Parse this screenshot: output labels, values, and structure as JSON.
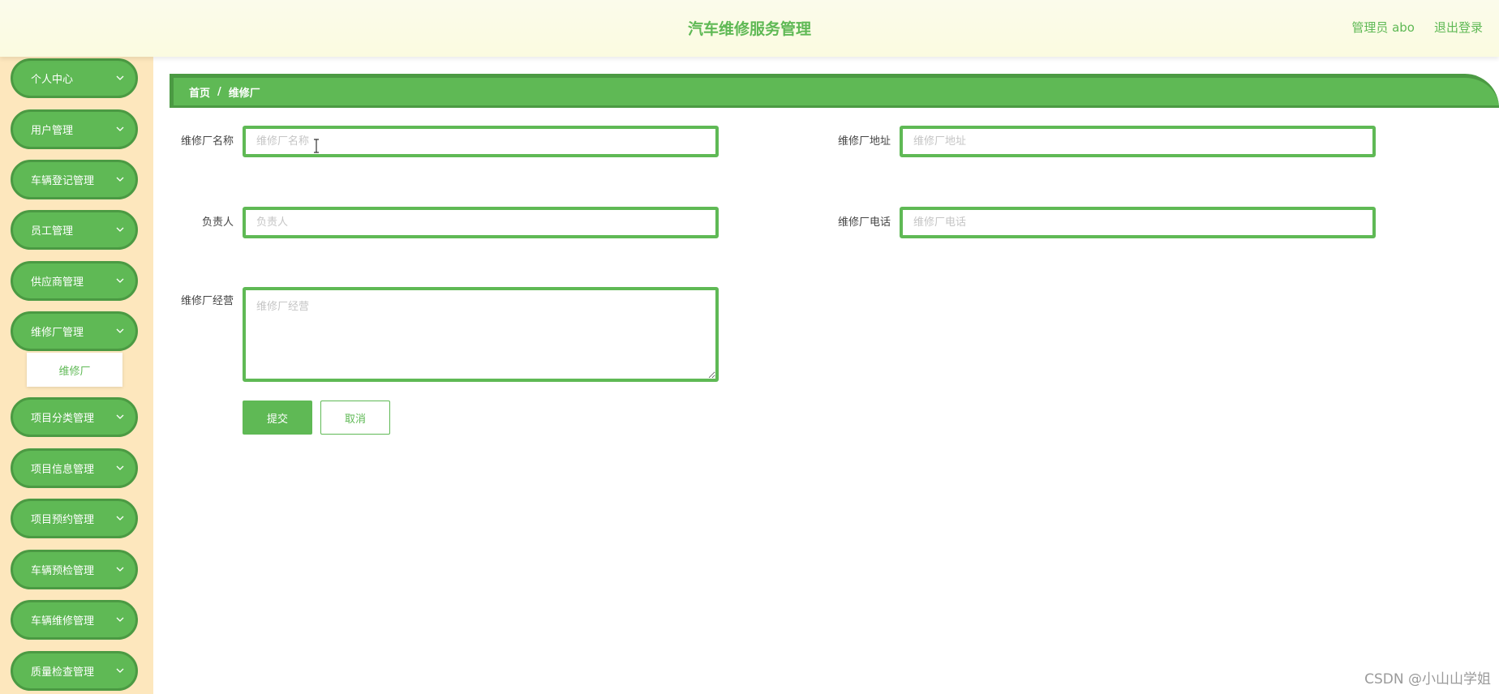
{
  "header": {
    "app_title": "汽车维修服务管理",
    "user_label": "管理员 abo",
    "logout_label": "退出登录"
  },
  "sidebar": {
    "items": [
      {
        "label": "个人中心"
      },
      {
        "label": "用户管理"
      },
      {
        "label": "车辆登记管理"
      },
      {
        "label": "员工管理"
      },
      {
        "label": "供应商管理"
      },
      {
        "label": "维修厂管理"
      },
      {
        "label": "项目分类管理"
      },
      {
        "label": "项目信息管理"
      },
      {
        "label": "项目预约管理"
      },
      {
        "label": "车辆预检管理"
      },
      {
        "label": "车辆维修管理"
      },
      {
        "label": "质量检查管理"
      }
    ],
    "submenu": {
      "label": "维修厂"
    }
  },
  "breadcrumb": {
    "home": "首页",
    "separator": "/",
    "current": "维修厂"
  },
  "form": {
    "name": {
      "label": "维修厂名称",
      "placeholder": "维修厂名称",
      "value": ""
    },
    "address": {
      "label": "维修厂地址",
      "placeholder": "维修厂地址",
      "value": ""
    },
    "manager": {
      "label": "负责人",
      "placeholder": "负责人",
      "value": ""
    },
    "phone": {
      "label": "维修厂电话",
      "placeholder": "维修厂电话",
      "value": ""
    },
    "business": {
      "label": "维修厂经营",
      "placeholder": "维修厂经营",
      "value": ""
    },
    "submit_label": "提交",
    "cancel_label": "取消"
  },
  "colors": {
    "primary": "#5fb955",
    "primary_dark": "#4b9a43",
    "sidebar_bg": "#fde7bd",
    "header_bg": "#fbfbeb"
  },
  "watermark": "CSDN @小山山学姐"
}
